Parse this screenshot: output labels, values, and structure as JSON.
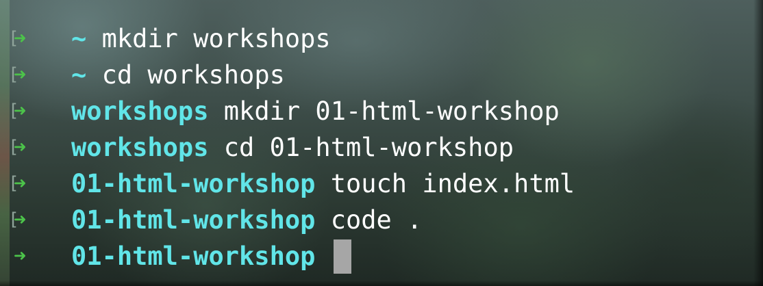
{
  "terminal": {
    "lines": [
      {
        "dir": "~",
        "command": "mkdir workshops"
      },
      {
        "dir": "~",
        "command": "cd workshops"
      },
      {
        "dir": "workshops",
        "command": "mkdir 01-html-workshop"
      },
      {
        "dir": "workshops",
        "command": "cd 01-html-workshop"
      },
      {
        "dir": "01-html-workshop",
        "command": "touch index.html"
      },
      {
        "dir": "01-html-workshop",
        "command": "code ."
      },
      {
        "dir": "01-html-workshop",
        "command": ""
      }
    ],
    "prompt_symbol": "➜",
    "colors": {
      "arrow": "#4cc34a",
      "directory": "#61e5e8",
      "text": "#ffffff",
      "cursor": "#a6a6a6"
    }
  }
}
